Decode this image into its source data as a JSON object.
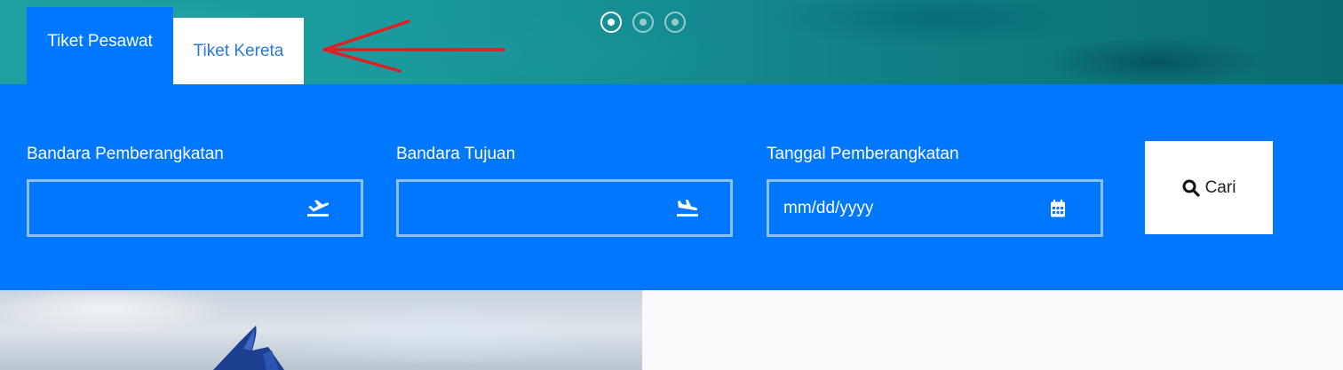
{
  "tabs": [
    {
      "label": "Tiket Pesawat",
      "active": true
    },
    {
      "label": "Tiket Kereta",
      "active": false
    }
  ],
  "carousel": {
    "count": 3,
    "active_index": 0
  },
  "search": {
    "departure": {
      "label": "Bandara Pemberangkatan",
      "value": "",
      "icon": "plane-takeoff-icon"
    },
    "arrival": {
      "label": "Bandara Tujuan",
      "value": "",
      "icon": "plane-landing-icon"
    },
    "date": {
      "label": "Tanggal Pemberangkatan",
      "placeholder": "mm/dd/yyyy",
      "icon": "calendar-icon"
    },
    "button_label": "Cari"
  },
  "colors": {
    "primary": "#0077ff",
    "tab_inactive_text": "#2a7bd6",
    "annotation_arrow": "#e02020"
  }
}
